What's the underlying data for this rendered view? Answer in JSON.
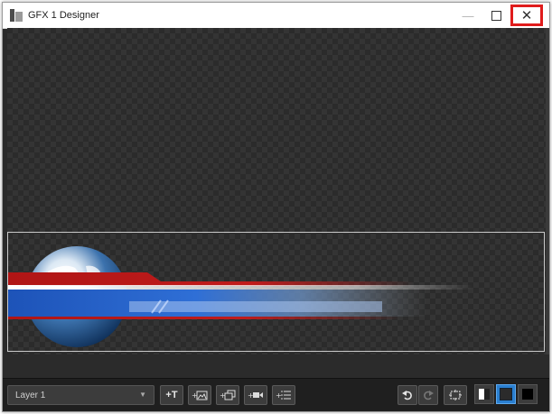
{
  "window": {
    "title": "GFX 1 Designer"
  },
  "titlebar_buttons": {
    "minimize_icon": "minimize-icon",
    "maximize_icon": "maximize-icon",
    "close_icon": "close-icon",
    "close_glyph": "✕",
    "minimize_glyph": "—"
  },
  "toolbar": {
    "layer_select": {
      "value": "Layer 1"
    },
    "add_buttons": [
      {
        "name": "add-text-button",
        "icon": "text-icon",
        "label": "+T"
      },
      {
        "name": "add-image-button",
        "icon": "image-icon"
      },
      {
        "name": "add-slideshow-button",
        "icon": "slideshow-icon"
      },
      {
        "name": "add-video-button",
        "icon": "video-icon"
      },
      {
        "name": "add-list-button",
        "icon": "list-icon"
      }
    ],
    "undo_icon": "undo-icon",
    "redo_icon": "redo-icon",
    "fit_icon": "fit-to-screen-icon",
    "background_modes": [
      "checkerboard",
      "dark",
      "black"
    ],
    "active_background": "dark"
  },
  "colors": {
    "accent": "#2a7fd0",
    "highlight": "#e01c1c",
    "canvas": "#2b2b2b"
  }
}
